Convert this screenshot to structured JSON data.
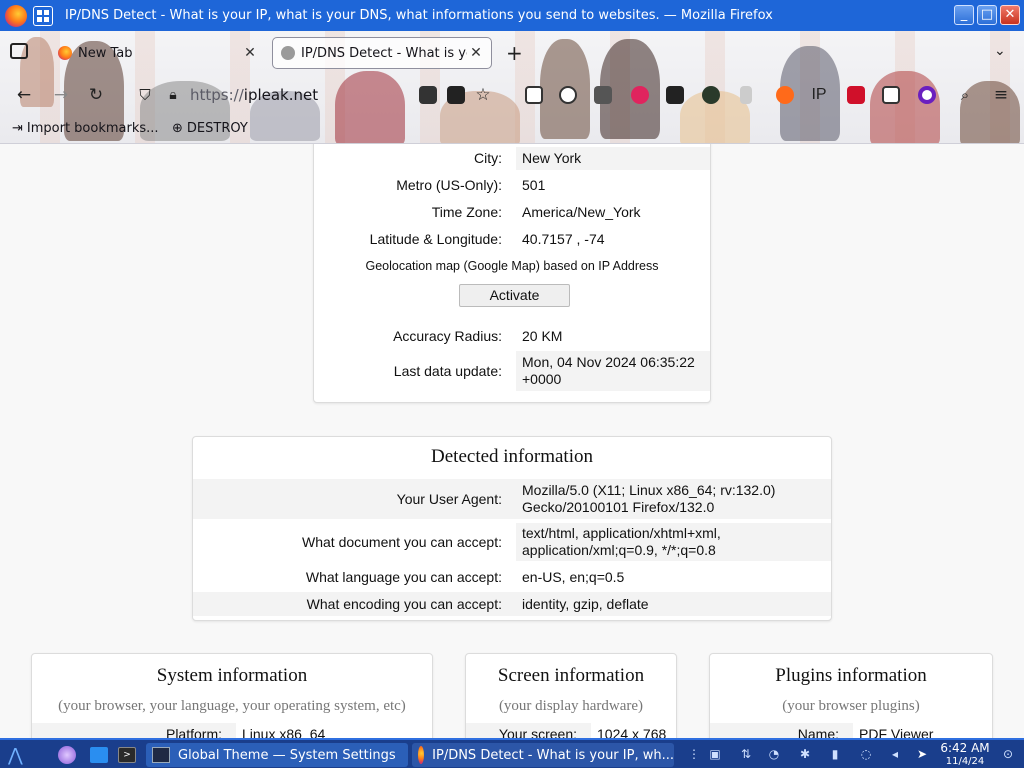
{
  "window": {
    "title": "IP/DNS Detect - What is your IP, what is your DNS, what informations you send to websites. — Mozilla Firefox",
    "controls": {
      "minimize": "_",
      "maximize": "□",
      "close": "✕"
    }
  },
  "tabs": [
    {
      "label": "New Tab",
      "active": false
    },
    {
      "label": "IP/DNS Detect - What is yo",
      "active": true
    }
  ],
  "tab_controls": {
    "new_tab": "+",
    "list_all": "⌄"
  },
  "navbar": {
    "url_scheme": "https://",
    "url_host": "ipleak.net",
    "ext_ip_label": "IP"
  },
  "bookmarks": [
    {
      "label": "Import bookmarks..."
    },
    {
      "label": "DESTROY"
    }
  ],
  "geo": {
    "rows": [
      {
        "label": "City:",
        "value": "New York"
      },
      {
        "label": "Metro (US-Only):",
        "value": "501"
      },
      {
        "label": "Time Zone:",
        "value": "America/New_York"
      },
      {
        "label": "Latitude & Longitude:",
        "value": "40.7157 , -74"
      }
    ],
    "map_caption": "Geolocation map (Google Map) based on IP Address",
    "activate_label": "Activate",
    "accuracy_label": "Accuracy Radius:",
    "accuracy_value": "20 KM",
    "update_label": "Last data update:",
    "update_value": "Mon, 04 Nov 2024 06:35:22 +0000"
  },
  "detected": {
    "title": "Detected information",
    "rows": [
      {
        "label": "Your User Agent:",
        "value": "Mozilla/5.0 (X11; Linux x86_64; rv:132.0) Gecko/20100101 Firefox/132.0"
      },
      {
        "label": "What document you can accept:",
        "value": "text/html, application/xhtml+xml, application/xml;q=0.9, */*;q=0.8"
      },
      {
        "label": "What language you can accept:",
        "value": "en-US, en;q=0.5"
      },
      {
        "label": "What encoding you can accept:",
        "value": "identity, gzip, deflate"
      }
    ]
  },
  "system": {
    "title": "System information",
    "subtitle": "(your browser, your language, your operating system, etc)",
    "row_label": "Platform:",
    "row_value": "Linux x86_64"
  },
  "screen": {
    "title": "Screen information",
    "subtitle": "(your display hardware)",
    "row_label": "Your screen:",
    "row_value": "1024 x 768"
  },
  "plugins": {
    "title": "Plugins information",
    "subtitle": "(your browser plugins)",
    "row_label": "Name:",
    "row_value": "PDF Viewer"
  },
  "taskbar": {
    "tasks": [
      {
        "label": "Global Theme — System Settings"
      },
      {
        "label": "IP/DNS Detect - What is your IP, wh..."
      }
    ],
    "time": "6:42 AM",
    "date": "11/4/24"
  }
}
